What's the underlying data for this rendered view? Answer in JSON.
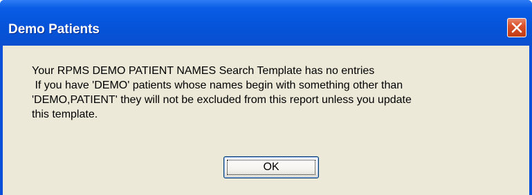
{
  "dialog": {
    "title": "Demo Patients",
    "close_icon": "close-icon",
    "message_lines": [
      "Your RPMS DEMO PATIENT NAMES Search Template has no entries",
      " If you have 'DEMO' patients whose names begin with something other than",
      "'DEMO,PATIENT' they will not be excluded from this report unless you update",
      "this template."
    ],
    "ok_label": "OK"
  },
  "colors": {
    "titlebar": "#0553d8",
    "client_background": "#ece9d8",
    "close_button": "#d9502a"
  }
}
